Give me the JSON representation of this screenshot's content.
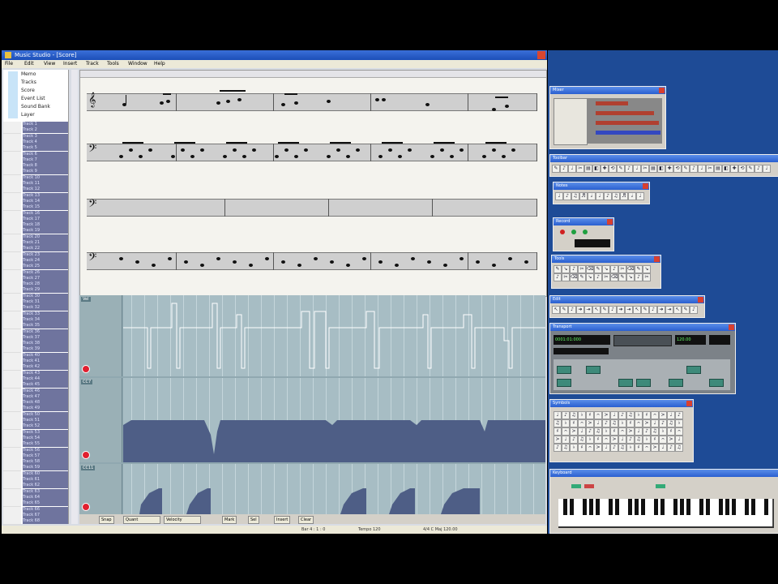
{
  "main_window": {
    "title": "Music Studio - [Score]",
    "menus": [
      "File",
      "Edit",
      "View",
      "Insert",
      "Track",
      "Tools",
      "Window",
      "Help"
    ]
  },
  "tree": [
    "Memo",
    "Tracks",
    "Score",
    "Event List",
    "Sound Bank",
    "Layer"
  ],
  "track_label": "Track",
  "score": {
    "staffs": [
      "treble-melody",
      "bass-rhythm",
      "bass-pad",
      "bass-percussion"
    ]
  },
  "lanes": [
    {
      "tag": "Vel"
    },
    {
      "tag": "CC7"
    },
    {
      "tag": "CC11"
    }
  ],
  "bottom_bar": {
    "buttons": [
      "Snap",
      "Quant",
      "Velocity",
      "Mark",
      "Sel",
      "Insert",
      "Clear"
    ]
  },
  "status": {
    "left": "Bar 4 : 1 : 0",
    "mid": "Tempo 120",
    "right": "4/4  C Maj  120.00"
  },
  "palettes": {
    "mixer": "Mixer",
    "toolbar": "Toolbar",
    "notes": "Notes",
    "record": "Record",
    "tools": "Tools",
    "edit": "Edit",
    "transport": "Transport",
    "symbols": "Symbols",
    "keyboard": "Keyboard"
  },
  "transport_lcd": {
    "time": "0001:01:000",
    "tempo": "120.00"
  },
  "colors": {
    "desktop": "#1e4b96",
    "track_name_bg": "#6f749e",
    "lane_fill": "#4e5e86"
  }
}
